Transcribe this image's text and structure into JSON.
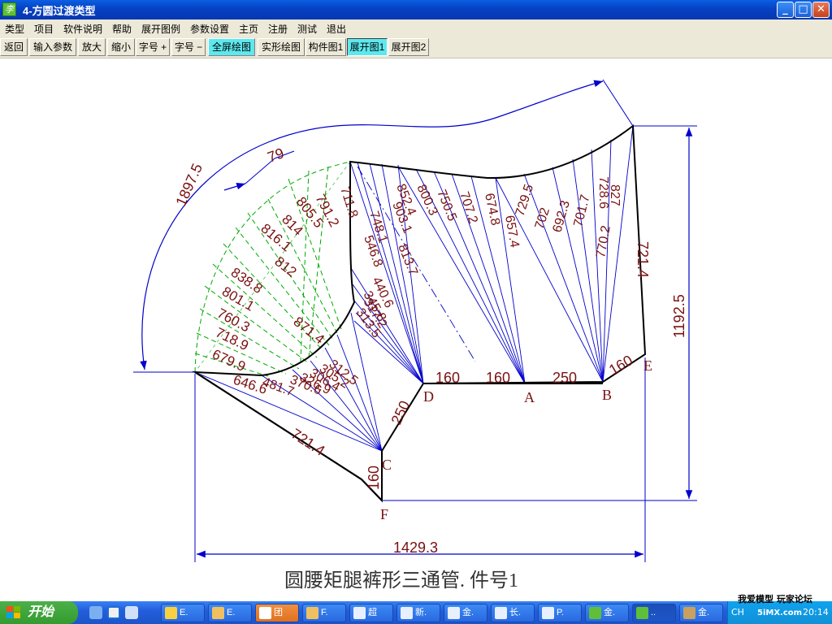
{
  "window": {
    "title": "4-方圆过渡类型",
    "app_icon_glyph": "李"
  },
  "controls": {
    "minimize": "_",
    "maximize": "□",
    "close": "✕"
  },
  "menu": [
    "类型",
    "项目",
    "软件说明",
    "帮助",
    "展开图例",
    "参数设置",
    "主页",
    "注册",
    "测试",
    "退出"
  ],
  "toolbar": [
    "返回",
    "输入参数",
    "放大",
    "缩小",
    "字号 +",
    "字号 −",
    "全屏绘图",
    "实形绘图",
    "构件图1",
    "展开图1",
    "展开图2"
  ],
  "drawing": {
    "caption": "圆腰矩腿裤形三通管. 件号1",
    "dim_arc": "1897.5",
    "dim_width_top": "79",
    "dim_total_width": "1429.3",
    "dim_total_height": "1192.5",
    "arc_lines": [
      "791.2",
      "805.5",
      "814",
      "816.1",
      "812",
      "838.8",
      "801.1",
      "760.3",
      "718.9",
      "679.9",
      "871.4",
      "646.6"
    ],
    "fan_D": [
      "711.8",
      "748.1",
      "546.8",
      "440.6",
      "345.8",
      "313.5",
      "317.2",
      "852.4",
      "903.1",
      "813.7"
    ],
    "fan_A": [
      "800.3",
      "750.5",
      "707.2",
      "674.8",
      "657.4",
      "729.5"
    ],
    "fan_B": [
      "702",
      "692.3",
      "701.7",
      "770.2",
      "728.6",
      "827"
    ],
    "fan_C": [
      "481.7",
      "370.6",
      "326.9",
      "306.4",
      "305.2",
      "312.5"
    ],
    "edge_E": "721.4",
    "edge_CF": "721.4",
    "seg_DA": "160",
    "seg_A_mid": "160",
    "seg_AB": "250",
    "seg_BE": "160",
    "seg_CD": "250",
    "seg_CF": "160",
    "points": {
      "A": "A",
      "B": "B",
      "C": "C",
      "D": "D",
      "E": "E",
      "F": "F"
    },
    "colors": {
      "pattern": "#000000",
      "fan": "#0000cc",
      "arc_grid": "#00aa00",
      "dim": "#0000cc",
      "label": "#7a1010"
    }
  },
  "taskbar": {
    "start": "开始",
    "tasks": [
      "E.",
      "E.",
      "团",
      "F.",
      "超",
      "新.",
      "金.",
      "长.",
      "P.",
      "金.",
      "..",
      "金."
    ],
    "tray_lang": "CH",
    "tray_text": "我爱模型 玩家论坛",
    "tray_site": "5iMX.com",
    "clock": "20:14"
  }
}
